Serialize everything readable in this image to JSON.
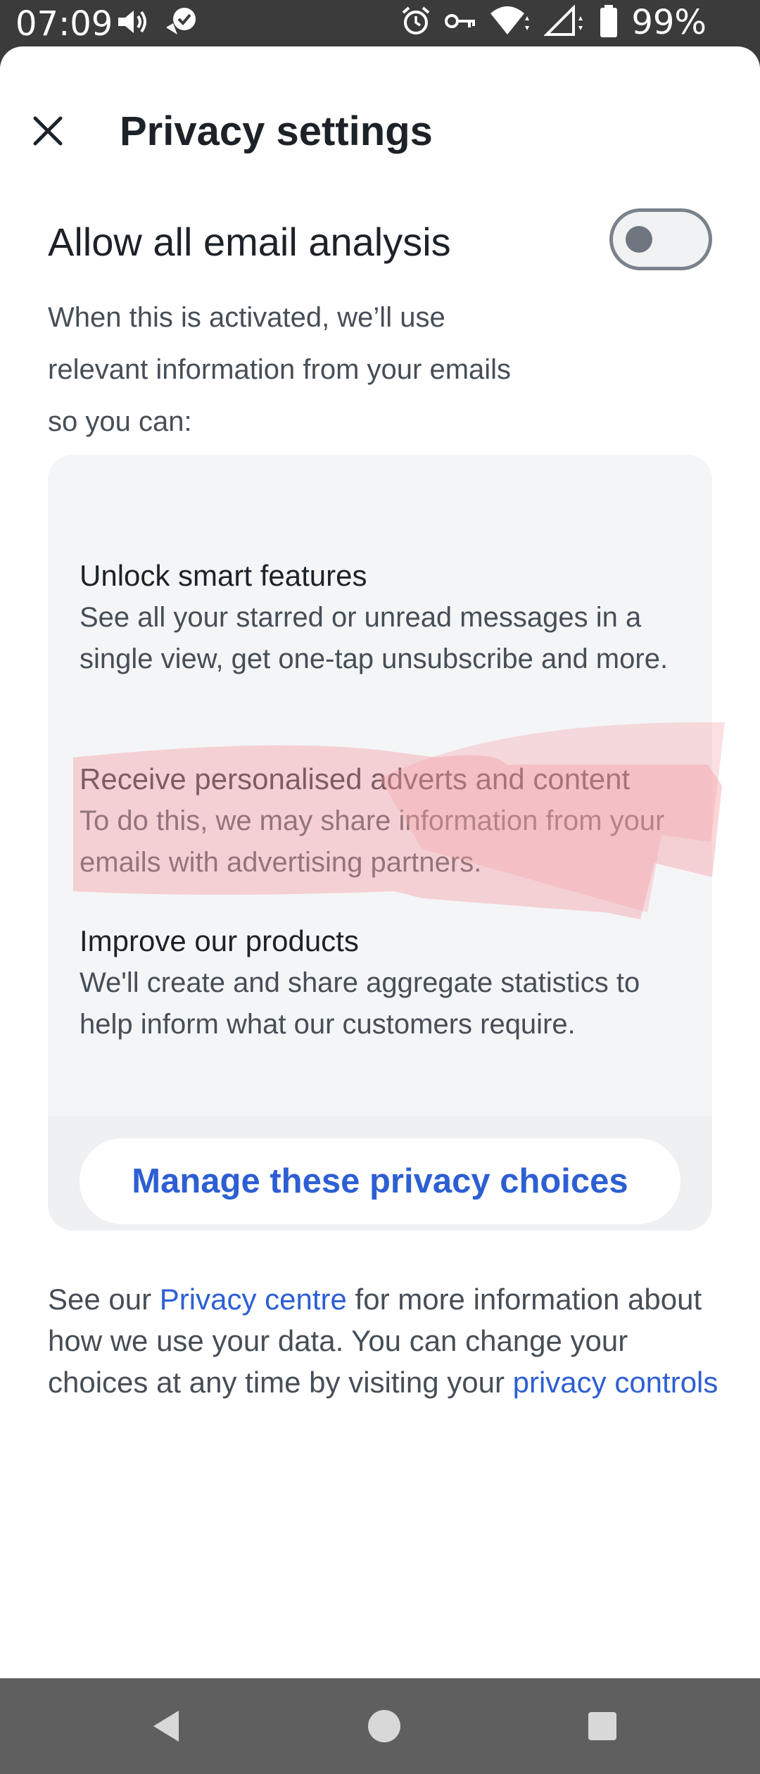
{
  "status_bar": {
    "time": "07:09",
    "battery": "99%",
    "icons": [
      "volume-icon",
      "check-badge-icon",
      "alarm-icon",
      "key-icon",
      "wifi-icon",
      "signal-icon",
      "battery-icon"
    ]
  },
  "header": {
    "title": "Privacy settings",
    "close_icon": "close-icon"
  },
  "email_analysis": {
    "title": "Allow all email analysis",
    "description": "When this is activated, we’ll use relevant information from your emails so you can:",
    "toggle_on": false
  },
  "features": [
    {
      "title": "Unlock smart features",
      "description": "See all your starred or unread messages in a single view, get one-tap unsubscribe and more."
    },
    {
      "title": "Receive personalised adverts and content",
      "description": "To do this, we may share information from your emails with advertising partners."
    },
    {
      "title": "Improve our products",
      "description": "We'll create and share aggregate statistics to help inform what our customers require."
    }
  ],
  "manage_button": "Manage these privacy choices",
  "footer": {
    "prefix": "See our ",
    "privacy_centre_link": "Privacy centre",
    "middle": " for more information about how we use your data. You can change your choices at any time by visiting your ",
    "privacy_controls_link": "privacy controls"
  },
  "nav_bar": {
    "back": "back-icon",
    "home": "home-icon",
    "recents": "recents-icon"
  },
  "colors": {
    "accent": "#2d5fd3",
    "text_primary": "#1d2228",
    "text_secondary": "#464e56",
    "card_bg": "#f4f5f7",
    "highlight": "#f4a3a8"
  }
}
